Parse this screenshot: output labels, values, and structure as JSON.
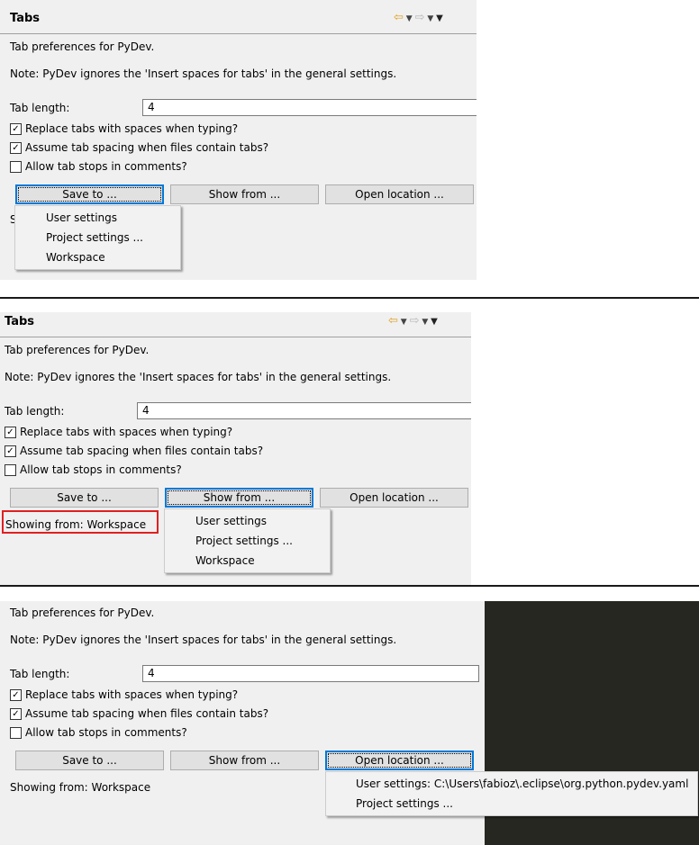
{
  "shot1": {
    "title": "Tabs",
    "desc": "Tab preferences for PyDev.",
    "note": "Note: PyDev ignores the 'Insert spaces for tabs' in the general settings.",
    "tab_length_label": "Tab length:",
    "tab_length_value": "4",
    "checkbox1": "Replace tabs with spaces when typing?",
    "checkbox2": "Assume tab spacing when files contain tabs?",
    "checkbox3": "Allow tab stops in comments?",
    "save_btn": "Save to ...",
    "show_btn": "Show from ...",
    "open_btn": "Open location ...",
    "partial_label": "S",
    "menu": [
      "User settings",
      "Project settings ...",
      "Workspace"
    ]
  },
  "shot2": {
    "title": "Tabs",
    "desc": "Tab preferences for PyDev.",
    "note": "Note: PyDev ignores the 'Insert spaces for tabs' in the general settings.",
    "tab_length_label": "Tab length:",
    "tab_length_value": "4",
    "checkbox1": "Replace tabs with spaces when typing?",
    "checkbox2": "Assume tab spacing when files contain tabs?",
    "checkbox3": "Allow tab stops in comments?",
    "save_btn": "Save to ...",
    "show_btn": "Show from ...",
    "open_btn": "Open location ...",
    "showing_from": "Showing from: Workspace",
    "menu": [
      "User settings",
      "Project settings ...",
      "Workspace"
    ]
  },
  "shot3": {
    "desc": "Tab preferences for PyDev.",
    "note": "Note: PyDev ignores the 'Insert spaces for tabs' in the general settings.",
    "tab_length_label": "Tab length:",
    "tab_length_value": "4",
    "checkbox1": "Replace tabs with spaces when typing?",
    "checkbox2": "Assume tab spacing when files contain tabs?",
    "checkbox3": "Allow tab stops in comments?",
    "save_btn": "Save to ...",
    "show_btn": "Show from ...",
    "open_btn": "Open location ...",
    "showing_from": "Showing from: Workspace",
    "menu": [
      "User settings: C:\\Users\\fabioz\\.eclipse\\org.python.pydev.yaml",
      "Project settings ..."
    ]
  },
  "colors": {
    "panel_bg": "#f0f0f0",
    "focus_border": "#0078d7",
    "highlight_red": "#e02020",
    "dark_bg": "#272722"
  },
  "icons": {
    "back": "back-arrow-icon",
    "forward": "forward-arrow-icon",
    "dropdown": "chevron-down-icon",
    "view_menu": "view-menu-icon"
  }
}
